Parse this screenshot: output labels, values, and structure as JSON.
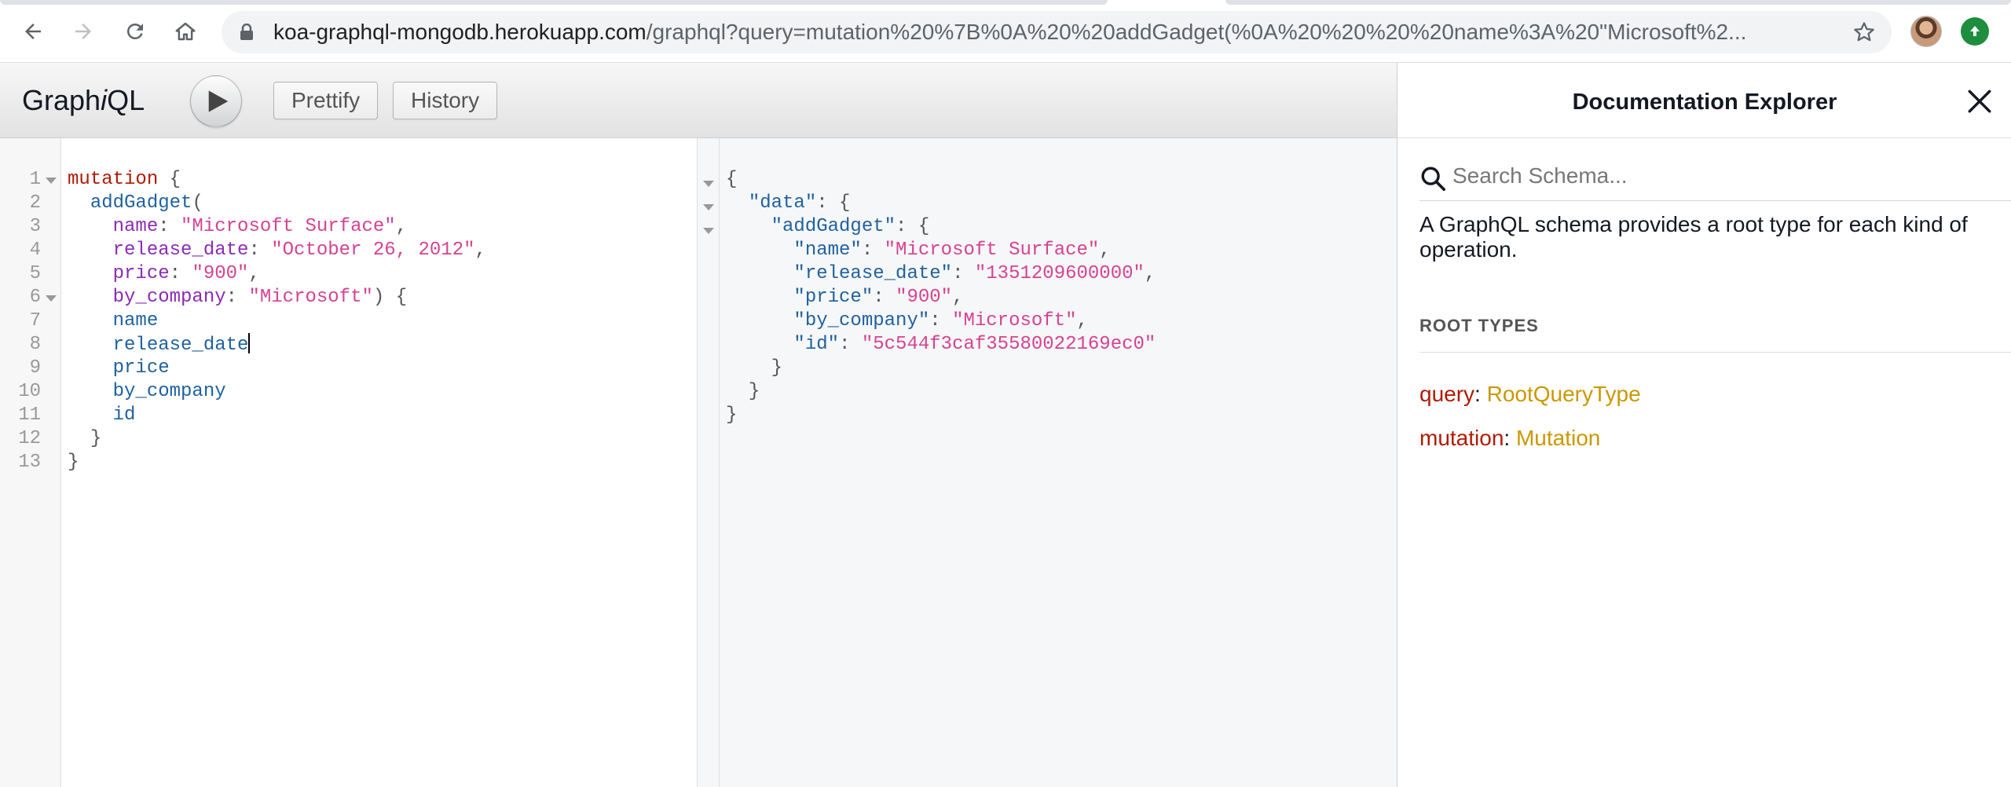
{
  "browser": {
    "url_host": "koa-graphql-mongodb.herokuapp.com",
    "url_path": "/graphql?query=mutation%20%7B%0A%20%20addGadget(%0A%20%20%20%20name%3A%20\"Microsoft%2...",
    "icons": [
      "back-arrow-icon",
      "forward-arrow-icon",
      "reload-icon",
      "home-icon",
      "lock-icon",
      "star-icon",
      "profile-avatar",
      "update-icon"
    ]
  },
  "toolbar": {
    "title_prefix": "Graph",
    "title_italic": "i",
    "title_suffix": "QL",
    "prettify_label": "Prettify",
    "history_label": "History"
  },
  "editor": {
    "line_numbers": [
      "1",
      "2",
      "3",
      "4",
      "5",
      "6",
      "7",
      "8",
      "9",
      "10",
      "11",
      "12",
      "13"
    ],
    "lines": [
      {
        "t1": "mutation",
        "t2": " {"
      },
      {
        "indent": "  ",
        "t1": "addGadget",
        "t2": "("
      },
      {
        "indent": "    ",
        "t1": "name",
        "t2": ": ",
        "t3": "\"Microsoft Surface\"",
        "t4": ","
      },
      {
        "indent": "    ",
        "t1": "release_date",
        "t2": ": ",
        "t3": "\"October 26, 2012\"",
        "t4": ","
      },
      {
        "indent": "    ",
        "t1": "price",
        "t2": ": ",
        "t3": "\"900\"",
        "t4": ","
      },
      {
        "indent": "    ",
        "t1": "by_company",
        "t2": ": ",
        "t3": "\"Microsoft\"",
        "t4": ") {"
      },
      {
        "indent": "    ",
        "t1": "name"
      },
      {
        "indent": "    ",
        "t1": "release_date"
      },
      {
        "indent": "    ",
        "t1": "price"
      },
      {
        "indent": "    ",
        "t1": "by_company"
      },
      {
        "indent": "    ",
        "t1": "id"
      },
      {
        "indent": "  ",
        "t1": "}"
      },
      {
        "t1": "}"
      }
    ]
  },
  "result": {
    "lines": [
      {
        "t1": "{"
      },
      {
        "indent": "  ",
        "k": "\"data\"",
        "t2": ": {"
      },
      {
        "indent": "    ",
        "k": "\"addGadget\"",
        "t2": ": {"
      },
      {
        "indent": "      ",
        "k": "\"name\"",
        "t2": ": ",
        "v": "\"Microsoft Surface\"",
        "t3": ","
      },
      {
        "indent": "      ",
        "k": "\"release_date\"",
        "t2": ": ",
        "v": "\"1351209600000\"",
        "t3": ","
      },
      {
        "indent": "      ",
        "k": "\"price\"",
        "t2": ": ",
        "v": "\"900\"",
        "t3": ","
      },
      {
        "indent": "      ",
        "k": "\"by_company\"",
        "t2": ": ",
        "v": "\"Microsoft\"",
        "t3": ","
      },
      {
        "indent": "      ",
        "k": "\"id\"",
        "t2": ": ",
        "v": "\"5c544f3caf35580022169ec0\""
      },
      {
        "indent": "    ",
        "t1": "}"
      },
      {
        "indent": "  ",
        "t1": "}"
      },
      {
        "t1": "}"
      }
    ]
  },
  "docs": {
    "title": "Documentation Explorer",
    "search_placeholder": "Search Schema...",
    "description": "A GraphQL schema provides a root type for each kind of operation.",
    "root_types_heading": "ROOT TYPES",
    "root_types": [
      {
        "field": "query",
        "sep": ": ",
        "type": "RootQueryType"
      },
      {
        "field": "mutation",
        "sep": ": ",
        "type": "Mutation"
      }
    ]
  },
  "colors": {
    "keyword": "#b11a04",
    "field": "#1f61a0",
    "argument": "#8b2bb9",
    "string": "#d64292",
    "type": "#ca9800"
  }
}
